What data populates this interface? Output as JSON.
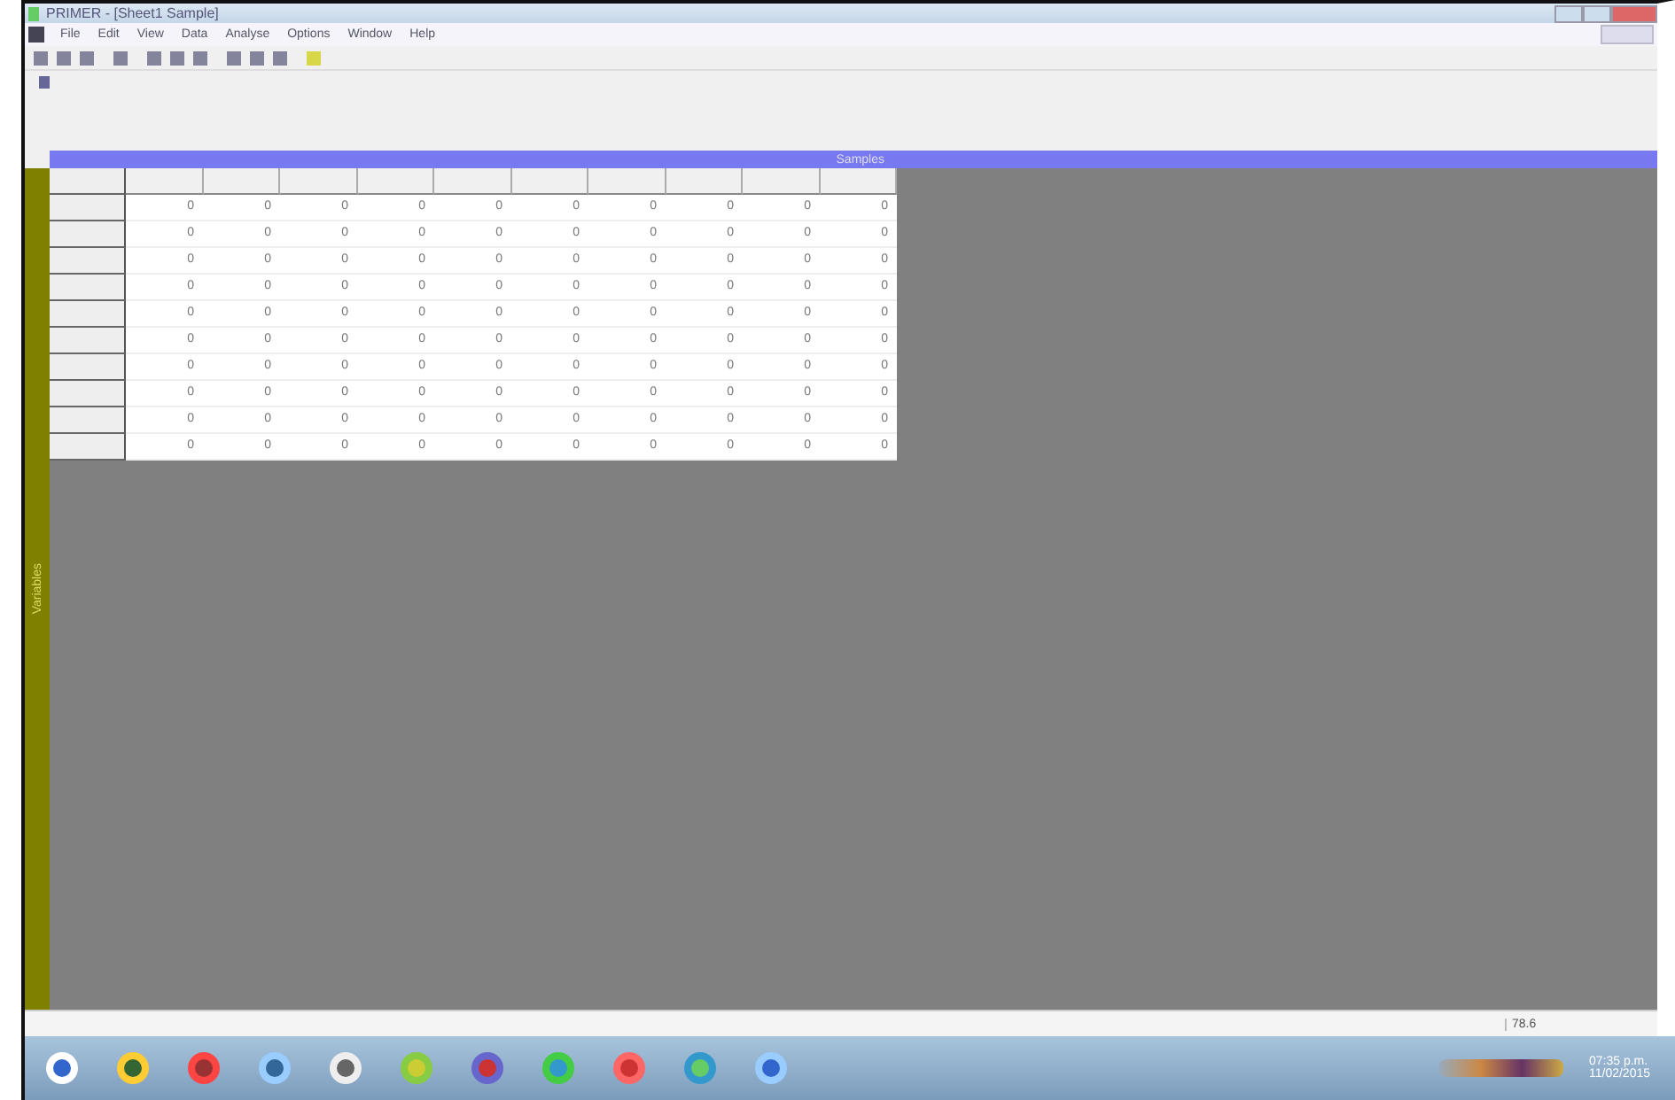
{
  "window": {
    "title": "PRIMER - [Sheet1 Sample]"
  },
  "menu": [
    "File",
    "Edit",
    "View",
    "Data",
    "Analyse",
    "Options",
    "Window",
    "Help"
  ],
  "samples_header": "Samples",
  "variables_label": "Variables",
  "grid": {
    "rows": [
      [
        "0",
        "0",
        "0",
        "0",
        "0",
        "0",
        "0",
        "0",
        "0",
        "0"
      ],
      [
        "0",
        "0",
        "0",
        "0",
        "0",
        "0",
        "0",
        "0",
        "0",
        "0"
      ],
      [
        "0",
        "0",
        "0",
        "0",
        "0",
        "0",
        "0",
        "0",
        "0",
        "0"
      ],
      [
        "0",
        "0",
        "0",
        "0",
        "0",
        "0",
        "0",
        "0",
        "0",
        "0"
      ],
      [
        "0",
        "0",
        "0",
        "0",
        "0",
        "0",
        "0",
        "0",
        "0",
        "0"
      ],
      [
        "0",
        "0",
        "0",
        "0",
        "0",
        "0",
        "0",
        "0",
        "0",
        "0"
      ],
      [
        "0",
        "0",
        "0",
        "0",
        "0",
        "0",
        "0",
        "0",
        "0",
        "0"
      ],
      [
        "0",
        "0",
        "0",
        "0",
        "0",
        "0",
        "0",
        "0",
        "0",
        "0"
      ],
      [
        "0",
        "0",
        "0",
        "0",
        "0",
        "0",
        "0",
        "0",
        "0",
        "0"
      ],
      [
        "0",
        "0",
        "0",
        "0",
        "0",
        "0",
        "0",
        "0",
        "0",
        "0"
      ]
    ]
  },
  "status_bar": {
    "reading": "78.6"
  },
  "taskbar": {
    "clock_time": "07:35 p.m.",
    "clock_date": "11/02/2015"
  }
}
